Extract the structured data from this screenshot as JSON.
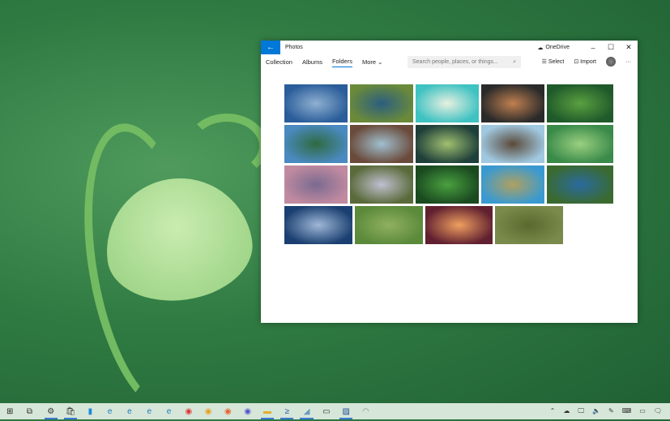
{
  "window": {
    "title": "Photos",
    "onedrive": "OneDrive",
    "minimize": "–",
    "maximize": "☐",
    "close": "✕",
    "back": "←"
  },
  "nav": {
    "tabs": [
      {
        "label": "Collection"
      },
      {
        "label": "Albums"
      },
      {
        "label": "Folders",
        "active": true
      },
      {
        "label": "More ⌄"
      }
    ]
  },
  "search": {
    "placeholder": "Search people, places, or things..."
  },
  "toolbar": {
    "select": "Select",
    "import": "Import",
    "more": "···"
  },
  "accent": "#0078d7",
  "photos": [
    [
      "#2a5d9a",
      "#8fb0d0"
    ],
    [
      "#6a8a3a",
      "#2b5e80"
    ],
    [
      "#3fc2c2",
      "#e8f0e0"
    ],
    [
      "#2a2a2a",
      "#c08050"
    ],
    [
      "#1f5a2a",
      "#5aa040"
    ],
    [
      "#4a8ac0",
      "#2f6a40"
    ],
    [
      "#6a4a3a",
      "#a0c0d0"
    ],
    [
      "#1f3f3a",
      "#a0c070"
    ],
    [
      "#a0c8e0",
      "#5a4a3a"
    ],
    [
      "#3a8a4a",
      "#9ad080"
    ],
    [
      "#c08aa0",
      "#7a6a90"
    ],
    [
      "#5a6a3a",
      "#c0c0d0"
    ],
    [
      "#1a4a20",
      "#4aa040"
    ],
    [
      "#3a9ad0",
      "#b0a060"
    ],
    [
      "#3a6a30",
      "#2a6aa0"
    ],
    [
      "#1a3f70",
      "#a0b8d8"
    ],
    [
      "#5a8a3a",
      "#90b060"
    ],
    [
      "#602030",
      "#f0a060"
    ],
    [
      "#7a8a4a",
      "#5a6a30"
    ]
  ],
  "taskbar": {
    "icons": [
      "start-icon",
      "task-view-icon",
      "settings-icon",
      "store-icon",
      "phone-icon",
      "edge-icon",
      "edge-beta-icon",
      "edge-dev-icon",
      "edge-canary-icon",
      "chrome-icon",
      "chrome-canary-icon",
      "firefox-icon",
      "firefox-nightly-icon",
      "file-explorer-icon",
      "powershell-icon",
      "app-icon",
      "terminal-icon",
      "photos-icon",
      "app2-icon"
    ],
    "glyphs": [
      "⊞",
      "⧉",
      "⚙",
      "🛍",
      "▮",
      "e",
      "e",
      "e",
      "e",
      "◉",
      "◉",
      "◉",
      "◉",
      "▬",
      "≥",
      "◢",
      "▭",
      "▨",
      "◠"
    ],
    "colors": [
      "#222",
      "#333",
      "#333",
      "#333",
      "#1a8ad8",
      "#1a7ac0",
      "#1a7ac0",
      "#1a7ac0",
      "#1a7ac0",
      "#d33",
      "#e8a020",
      "#e8602a",
      "#5050d0",
      "#e0b030",
      "#2a5ab0",
      "#6a9ac0",
      "#333",
      "#1a4a90",
      "#889"
    ],
    "active": [
      2,
      3,
      13,
      14,
      15,
      17
    ],
    "tray": [
      "⌃",
      "☁",
      "🖵",
      "🔈",
      "✎",
      "⌨",
      "▭",
      "🗨"
    ]
  }
}
